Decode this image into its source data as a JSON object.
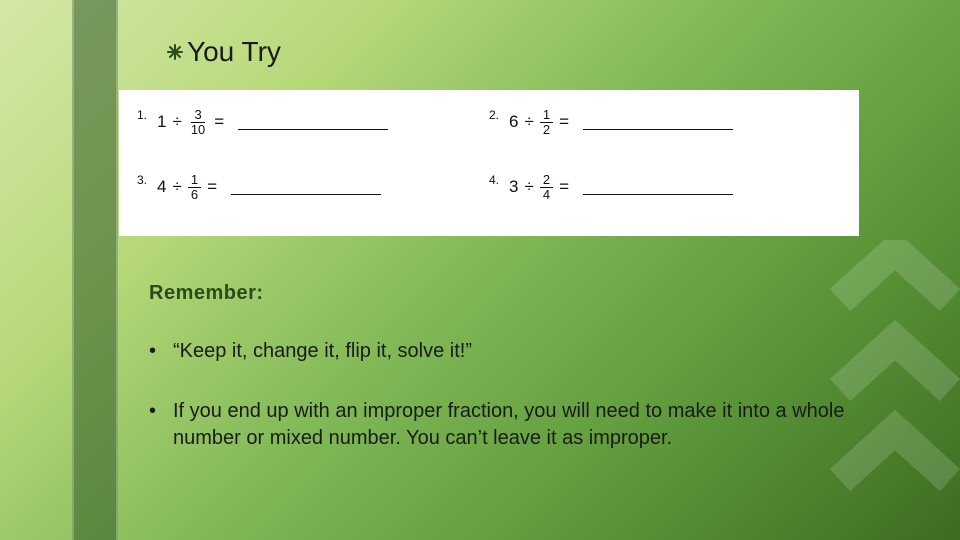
{
  "title": "You Try",
  "problems": [
    {
      "n": "1.",
      "whole": "1",
      "op": "÷",
      "fnum": "3",
      "fden": "10",
      "eq": "="
    },
    {
      "n": "2.",
      "whole": "6",
      "op": "÷",
      "fnum": "1",
      "fden": "2",
      "eq": "="
    },
    {
      "n": "3.",
      "whole": "4",
      "op": "÷",
      "fnum": "1",
      "fden": "6",
      "eq": "="
    },
    {
      "n": "4.",
      "whole": "3",
      "op": "÷",
      "fnum": "2",
      "fden": "4",
      "eq": "="
    }
  ],
  "remember_label": "Remember:",
  "bullets": [
    "“Keep it, change it, flip it, solve it!”",
    "If you end up with an improper fraction, you will need to make it into a whole number or mixed number. You can’t leave it as improper."
  ]
}
